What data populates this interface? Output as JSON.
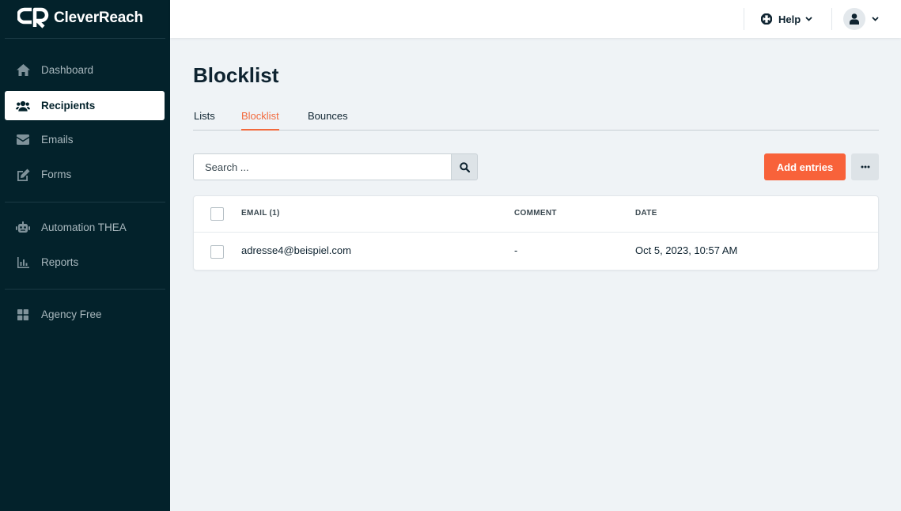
{
  "brand": {
    "name": "CleverReach",
    "accent": "#f8623a",
    "sidebar_bg": "#03222b"
  },
  "sidebar": {
    "items": [
      {
        "label": "Dashboard",
        "icon": "home-icon"
      },
      {
        "label": "Recipients",
        "icon": "users-icon",
        "active": true
      },
      {
        "label": "Emails",
        "icon": "envelope-icon"
      },
      {
        "label": "Forms",
        "icon": "edit-icon"
      },
      {
        "label": "Automation THEA",
        "icon": "robot-icon"
      },
      {
        "label": "Reports",
        "icon": "bar-chart-icon"
      },
      {
        "label": "Agency Free",
        "icon": "grid-icon"
      }
    ]
  },
  "topbar": {
    "help_label": "Help"
  },
  "page": {
    "title": "Blocklist",
    "tabs": [
      {
        "label": "Lists"
      },
      {
        "label": "Blocklist",
        "active": true
      },
      {
        "label": "Bounces"
      }
    ]
  },
  "search": {
    "placeholder": "Search ..."
  },
  "actions": {
    "add_label": "Add entries"
  },
  "table": {
    "columns": [
      "EMAIL (1)",
      "COMMENT",
      "DATE"
    ],
    "rows": [
      {
        "email": "adresse4@beispiel.com",
        "comment": "-",
        "date": "Oct 5, 2023, 10:57 AM"
      }
    ]
  }
}
